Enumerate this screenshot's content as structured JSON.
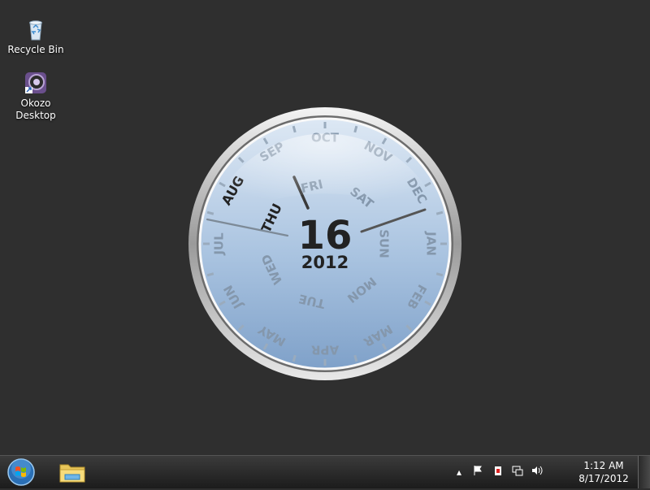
{
  "desktop_icons": [
    {
      "id": "recycle-bin",
      "label": "Recycle Bin"
    },
    {
      "id": "okozo-desktop",
      "label": "Okozo\nDesktop"
    }
  ],
  "calendar_clock": {
    "day_number": "16",
    "year": "2012",
    "current_month": "AUG",
    "current_weekday": "THU",
    "months": [
      "JAN",
      "FEB",
      "MAR",
      "APR",
      "MAY",
      "JUN",
      "JUL",
      "AUG",
      "SEP",
      "OCT",
      "NOV",
      "DEC"
    ],
    "weekdays": [
      "SUN",
      "MON",
      "TUE",
      "WED",
      "THU",
      "FRI",
      "SAT"
    ]
  },
  "taskbar": {
    "tray_time": "1:12 AM",
    "tray_date": "8/17/2012",
    "tray_icons": [
      "chevron-up-icon",
      "flag-icon",
      "power-icon",
      "network-icon",
      "volume-icon"
    ]
  },
  "colors": {
    "desktop_bg": "#2f2f2f",
    "clock_face_top": "#dbe6f3",
    "clock_face_bottom": "#86a8cf",
    "label_faded": "#8497ac",
    "label_active": "#222222"
  }
}
